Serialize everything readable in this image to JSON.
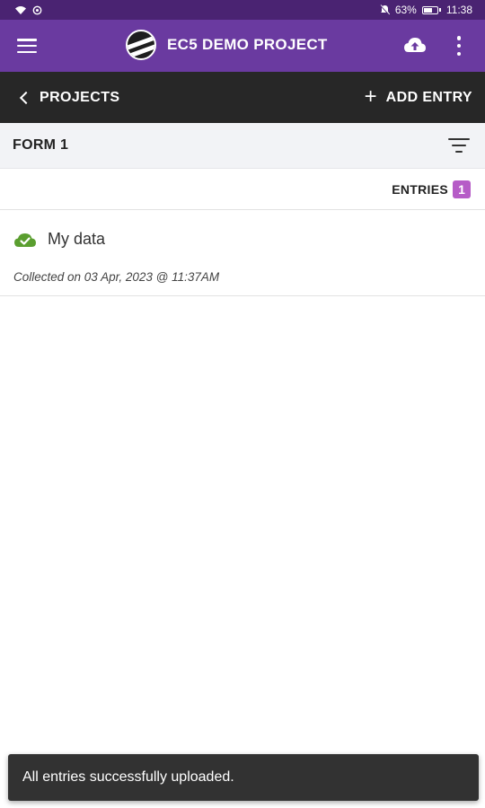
{
  "status_bar": {
    "battery_percent": "63%",
    "time": "11:38",
    "icons": [
      "wifi-icon",
      "hotspot-icon",
      "mute-icon",
      "battery-icon"
    ]
  },
  "app_bar": {
    "title": "EC5 DEMO PROJECT",
    "icons": [
      "menu-icon",
      "project-logo",
      "cloud-upload-icon",
      "more-vert-icon"
    ],
    "color": "#6a3aa0"
  },
  "nav_bar": {
    "back_label": "PROJECTS",
    "add_entry_label": "ADD ENTRY",
    "color": "#272727"
  },
  "form": {
    "title": "FORM 1"
  },
  "entries": {
    "label": "ENTRIES",
    "count": "1",
    "badge_color": "#b65cc7"
  },
  "entry_list": [
    {
      "title": "My data",
      "meta": "Collected on 03 Apr, 2023 @ 11:37AM",
      "status_icon": "cloud-check-icon",
      "status_color": "#5a9e2f"
    }
  ],
  "snackbar": {
    "message": "All entries successfully uploaded."
  }
}
